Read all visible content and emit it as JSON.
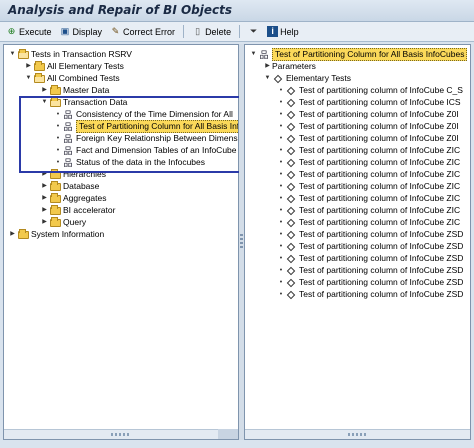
{
  "window": {
    "title": "Analysis and Repair of BI Objects"
  },
  "toolbar": {
    "buttons": [
      {
        "label": "Execute",
        "icon": "execute-icon"
      },
      {
        "label": "Display",
        "icon": "display-icon"
      },
      {
        "label": "Correct Error",
        "icon": "correct-error-icon"
      },
      {
        "label": "Delete",
        "icon": "delete-icon"
      },
      {
        "label": "",
        "icon": "filter-icon"
      },
      {
        "label": "Help",
        "icon": "help-icon"
      }
    ]
  },
  "left_tree": [
    {
      "label": "Tests in Transaction RSRV",
      "level": 0,
      "expanded": true,
      "icon": "folder-open-icon"
    },
    {
      "label": "All Elementary Tests",
      "level": 1,
      "expanded": false,
      "icon": "folder-icon"
    },
    {
      "label": "All Combined Tests",
      "level": 1,
      "expanded": true,
      "icon": "folder-open-icon"
    },
    {
      "label": "Master Data",
      "level": 2,
      "expanded": false,
      "icon": "folder-icon"
    },
    {
      "label": "Transaction Data",
      "level": 2,
      "expanded": true,
      "icon": "folder-open-icon"
    },
    {
      "label": "Consistency of the Time Dimension for All",
      "level": 3,
      "icon": "hierarchy-icon"
    },
    {
      "label": "Test of Partitioning Column for All Basis Inf",
      "level": 3,
      "icon": "hierarchy-icon",
      "selected": true
    },
    {
      "label": "Foreign Key Relationship Between Dimensi",
      "level": 3,
      "icon": "hierarchy-icon"
    },
    {
      "label": "Fact and Dimension Tables of an InfoCube",
      "level": 3,
      "icon": "hierarchy-icon"
    },
    {
      "label": "Status of the data in the Infocubes",
      "level": 3,
      "icon": "hierarchy-icon"
    },
    {
      "label": "Hierarchies",
      "level": 2,
      "expanded": false,
      "icon": "folder-icon"
    },
    {
      "label": "Database",
      "level": 2,
      "expanded": false,
      "icon": "folder-icon"
    },
    {
      "label": "Aggregates",
      "level": 2,
      "expanded": false,
      "icon": "folder-icon"
    },
    {
      "label": "BI accelerator",
      "level": 2,
      "expanded": false,
      "icon": "folder-icon"
    },
    {
      "label": "Query",
      "level": 2,
      "expanded": false,
      "icon": "folder-icon"
    },
    {
      "label": "System Information",
      "level": 0,
      "expanded": false,
      "icon": "folder-icon"
    }
  ],
  "right_tree": {
    "root": "Test of Partitioning Column for All Basis InfoCubes",
    "parameters": "Parameters",
    "elementary": "Elementary Tests",
    "items": [
      "Test of partitioning column of InfoCube C_S",
      "Test of partitioning column of InfoCube ICS",
      "Test of partitioning column of InfoCube Z0I",
      "Test of partitioning column of InfoCube Z0I",
      "Test of partitioning column of InfoCube Z0I",
      "Test of partitioning column of InfoCube ZIC",
      "Test of partitioning column of InfoCube ZIC",
      "Test of partitioning column of InfoCube ZIC",
      "Test of partitioning column of InfoCube ZIC",
      "Test of partitioning column of InfoCube ZIC",
      "Test of partitioning column of InfoCube ZIC",
      "Test of partitioning column of InfoCube ZIC",
      "Test of partitioning column of InfoCube ZSD",
      "Test of partitioning column of InfoCube ZSD",
      "Test of partitioning column of InfoCube ZSD",
      "Test of partitioning column of InfoCube ZSD",
      "Test of partitioning column of InfoCube ZSD",
      "Test of partitioning column of InfoCube ZSD"
    ]
  }
}
